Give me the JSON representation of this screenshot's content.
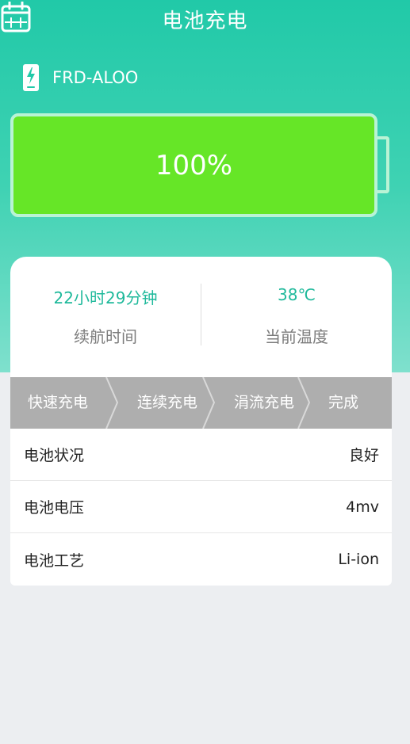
{
  "header": {
    "title": "电池充电",
    "calendar_icon": "calendar-icon"
  },
  "device": {
    "icon": "phone-charging-icon",
    "name": "FRD-ALOO"
  },
  "battery": {
    "percent_label": "100%",
    "level": 1.0,
    "fill_color": "#66e627",
    "border_color": "#b9f3d5"
  },
  "stats": {
    "endurance": {
      "value": "22小时29分钟",
      "label": "续航时间"
    },
    "temperature": {
      "value": "38℃",
      "label": "当前温度"
    },
    "accent_color": "#1fb99b"
  },
  "charge_steps": [
    "快速充电",
    "连续充电",
    "涓流充电",
    "完成"
  ],
  "info": [
    {
      "label": "电池状况",
      "value": "良好"
    },
    {
      "label": "电池电压",
      "value": "4mv"
    },
    {
      "label": "电池工艺",
      "value": "Li-ion"
    }
  ],
  "colors": {
    "primary": "#21c9a8",
    "steps_background": "#aeaeae",
    "page_background": "#eceef1"
  }
}
